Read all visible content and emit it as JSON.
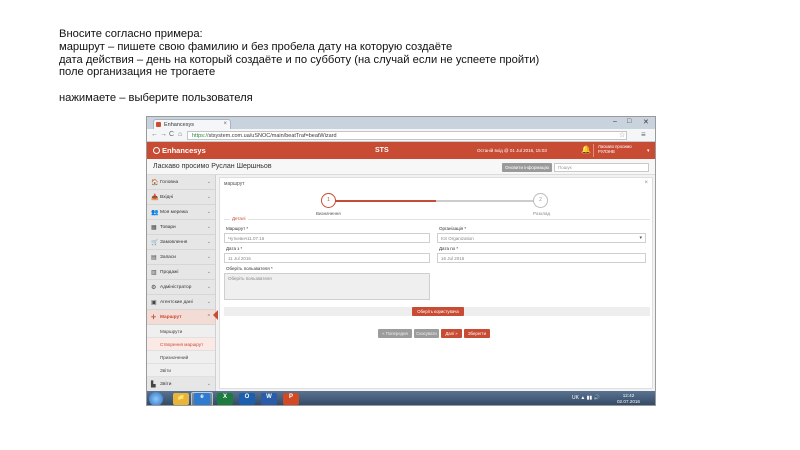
{
  "instructions": {
    "line1": "Вносите согласно примера:",
    "line2": "маршрут – пишете свою фамилию и без пробела дату на которую создаёте",
    "line3": "дата действия – день на который создаёте и по субботу (на случай если не успеете пройти)",
    "line4": "поле организация не трогаете",
    "line5": "нажимаете – выберите пользователя"
  },
  "browser": {
    "tab_label": "Enhancesys",
    "url_prefix": "https://",
    "url": "stsystem.com.ua/uSNOC/main/beatTraf=beatWizard",
    "close_glyph": "×",
    "back_glyph": "←",
    "forward_glyph": "→",
    "reload_glyph": "C",
    "home_glyph": "⌂",
    "star_glyph": "☆",
    "menu_glyph": "≡",
    "win_min": "–",
    "win_max": "□",
    "win_close": "✕"
  },
  "app": {
    "logo": "Enhancesys",
    "name": "STS",
    "status": "Останій вхід @ 01 Jul 2016, 15:03",
    "bell_glyph": "🔔",
    "user_line1": "Ласкаво просимо",
    "user_line2": "РУЛЭНВ",
    "user_menu": "▾",
    "accent": "#c84b34"
  },
  "userbar": {
    "greeting": "Ласкаво просимо Руслан Шершньов",
    "update_button": "Оновити інформацію",
    "search_placeholder": "Пошук"
  },
  "sidebar": {
    "items": [
      {
        "icon": "🏠",
        "label": "Головна",
        "chev": "⌄"
      },
      {
        "icon": "📥",
        "label": "Вхідні",
        "chev": "⌄"
      },
      {
        "icon": "👥",
        "label": "Моя мережа",
        "chev": "⌄"
      },
      {
        "icon": "▦",
        "label": "Товари",
        "chev": "⌄"
      },
      {
        "icon": "🛒",
        "label": "Замовлення",
        "chev": "⌄"
      },
      {
        "icon": "▤",
        "label": "Запаси",
        "chev": "⌄"
      },
      {
        "icon": "▥",
        "label": "Продажі",
        "chev": "⌄"
      },
      {
        "icon": "⚙",
        "label": "Адміністратор",
        "chev": "⌄"
      },
      {
        "icon": "▣",
        "label": "Агентские дані",
        "chev": "⌄"
      }
    ],
    "active_item": {
      "icon": "✛",
      "label": "Маршрут",
      "chev": "⌃"
    },
    "sub_items": [
      "Маршрути",
      "Створення маршрут",
      "Призначений",
      "Звіти"
    ],
    "last_item": {
      "icon": "▙",
      "label": "Звіти",
      "chev": "⌄"
    }
  },
  "content": {
    "title": "маршрут",
    "close_glyph": "×",
    "steps": [
      {
        "num": "1",
        "label": "Визначення"
      },
      {
        "num": "2",
        "label": "Розклад"
      }
    ],
    "section": "Деталі",
    "fields": {
      "route_label": "Маршрут *",
      "route_value": "Чуткевич11.07.16",
      "org_label": "Організація *",
      "org_value": "KS Organization",
      "org_chev": "▾",
      "date_from_label": "Дата з *",
      "date_from_value": "11 Jul 2016",
      "date_to_label": "Дата по *",
      "date_to_value": "16 Jul 2016",
      "desc_label": "Оберіть пользвателя *",
      "desc_placeholder": "Оберіть пользвателя"
    },
    "select_user_button": "Оберіть користувача",
    "buttons": {
      "back": "« Попередня",
      "cancel": "Скасувати",
      "next": "Далі »",
      "save": "Зберегти"
    }
  },
  "taskbar": {
    "apps": [
      {
        "label": "📁",
        "color": "#e8b43a"
      },
      {
        "label": "e",
        "color": "#2f7bd0"
      },
      {
        "label": "X",
        "color": "#1e7b3f"
      },
      {
        "label": "O",
        "color": "#1b5fae"
      },
      {
        "label": "W",
        "color": "#2a5caa"
      },
      {
        "label": "P",
        "color": "#d04a25"
      }
    ],
    "tray": "UK  ▲  ▮▮  🔊",
    "time": "12:42",
    "date": "02.07.2016"
  }
}
